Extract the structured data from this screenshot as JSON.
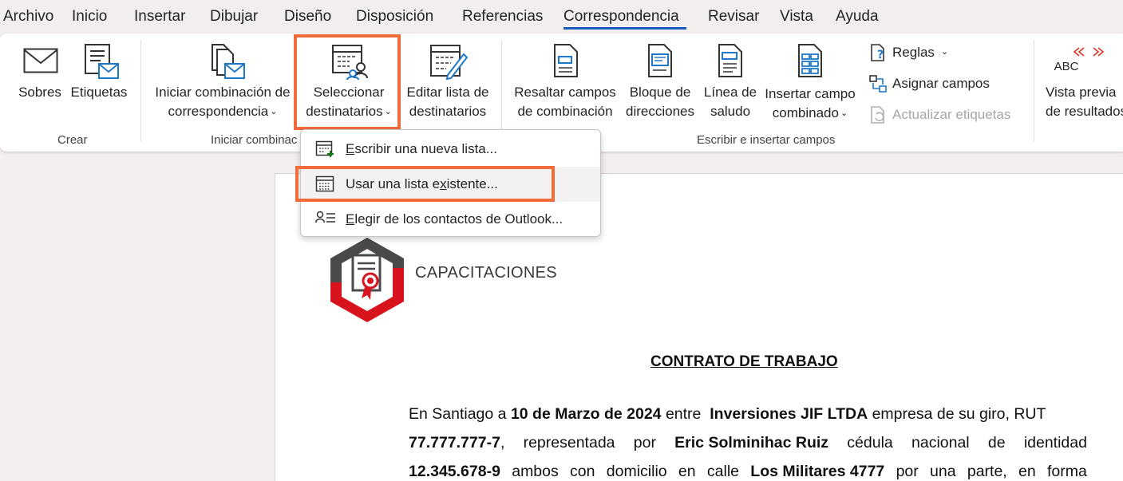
{
  "tabs": [
    "Archivo",
    "Inicio",
    "Insertar",
    "Dibujar",
    "Diseño",
    "Disposición",
    "Referencias",
    "Correspondencia",
    "Revisar",
    "Vista",
    "Ayuda"
  ],
  "active_tab": "Correspondencia",
  "accent_color": "#185abd",
  "highlight_color": "#f26b3a",
  "ribbon": {
    "sobres": "Sobres",
    "etiquetas": "Etiquetas",
    "group_crear": "Crear",
    "iniciar_line1": "Iniciar combinación de",
    "iniciar_line2": "correspondencia",
    "group_iniciar": "Iniciar combinac",
    "seleccionar_line1": "Seleccionar",
    "seleccionar_line2": "destinatarios",
    "editar_line1": "Editar lista de",
    "editar_line2": "destinatarios",
    "resaltar_line1": "Resaltar campos",
    "resaltar_line2": "de combinación",
    "bloque_line1": "Bloque de",
    "bloque_line2": "direcciones",
    "linea_line1": "Línea de",
    "linea_line2": "saludo",
    "insertar_line1": "Insertar campo",
    "insertar_line2": "combinado",
    "reglas": "Reglas",
    "asignar": "Asignar campos",
    "actualizar": "Actualizar etiquetas",
    "group_escribir": "Escribir e insertar campos",
    "vista_line1": "Vista previa",
    "vista_line2": "de resultados",
    "abc": "ABC"
  },
  "dropdown": {
    "items": [
      {
        "pre": "",
        "key": "E",
        "post": "scribir una nueva lista..."
      },
      {
        "pre": "Usar una lista e",
        "key": "x",
        "post": "istente..."
      },
      {
        "pre": "",
        "key": "E",
        "post": "legir de los contactos de Outlook..."
      }
    ]
  },
  "document": {
    "brand": "CAPACITACIONES",
    "title": "CONTRATO DE TRABAJO",
    "line1": {
      "a": "En Santiago a ",
      "b": "10 de Marzo de 2024",
      "c": " entre  ",
      "d": "Inversiones JIF LTDA",
      "e": " empresa de su giro, RUT"
    },
    "line2": [
      "77.777.777-7",
      ",",
      "representada",
      "por",
      "Eric Solminihac Ruiz",
      "cédula",
      "nacional",
      "de",
      "identidad"
    ],
    "line3": [
      "12.345.678-9",
      "ambos",
      "con",
      "domicilio",
      "en",
      "calle",
      "Los Militares 4777",
      "por",
      "una",
      "parte,",
      "en",
      "forma"
    ]
  }
}
